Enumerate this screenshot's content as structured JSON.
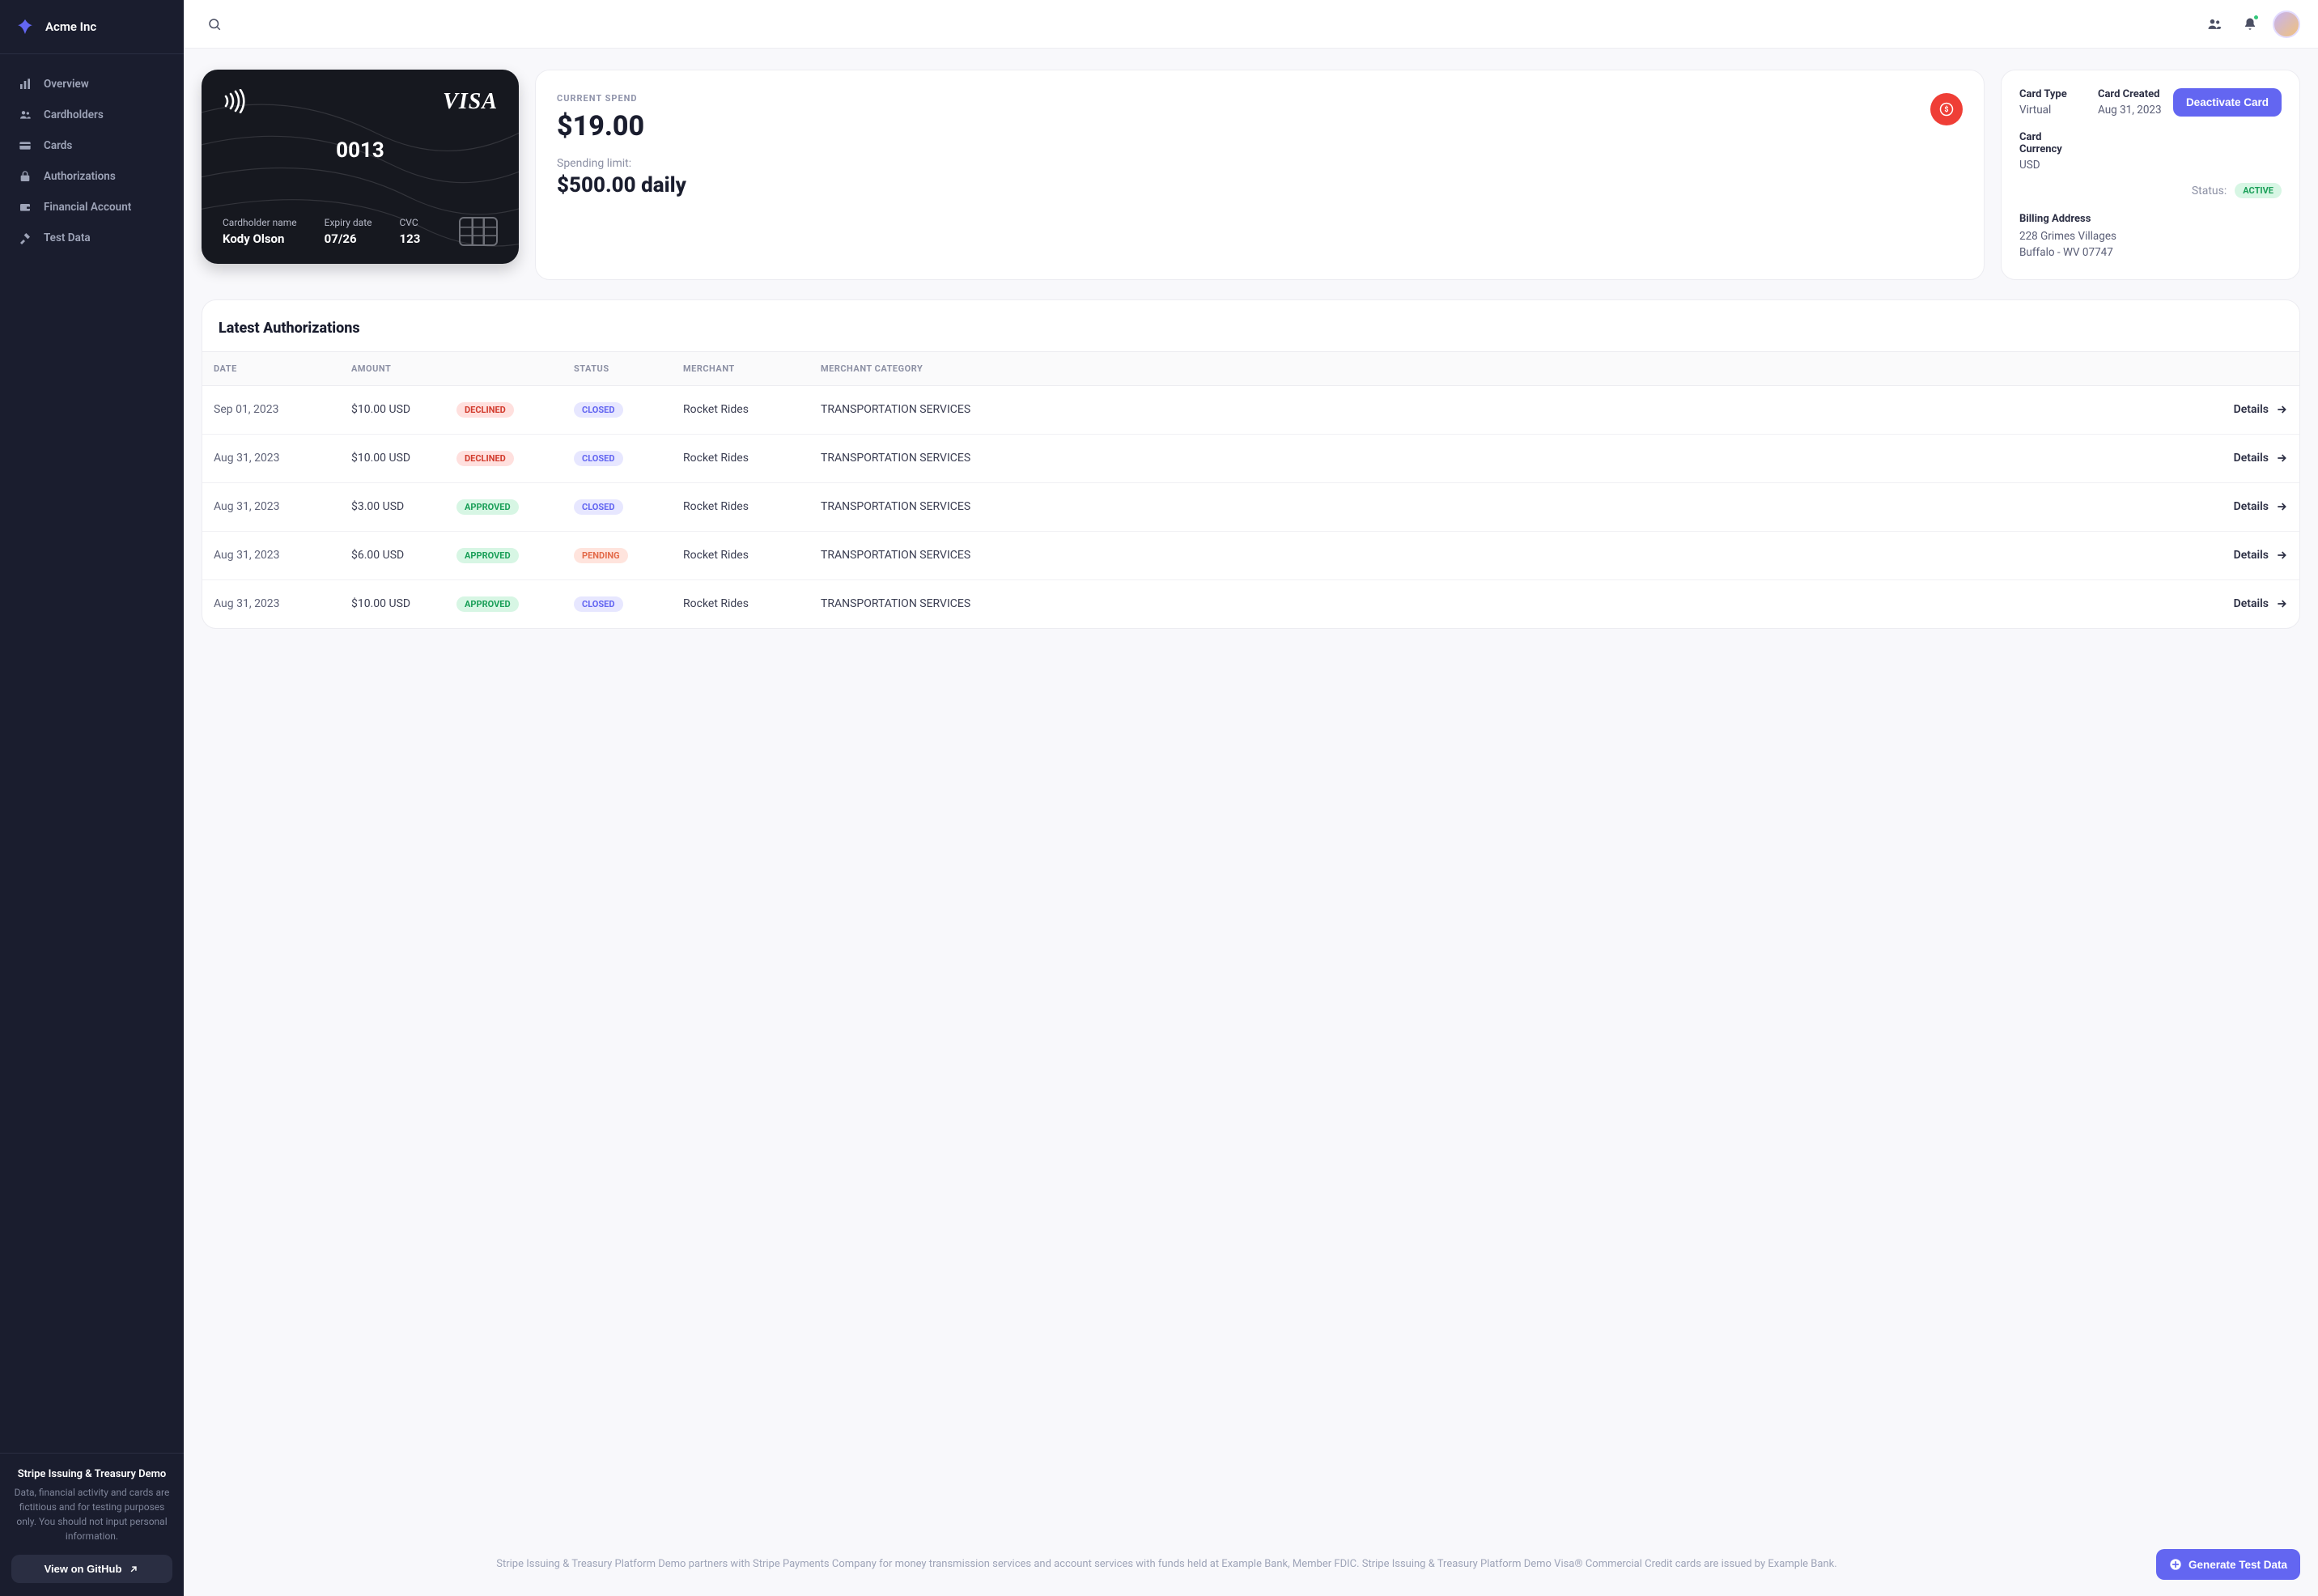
{
  "brand": {
    "name": "Acme Inc"
  },
  "sidebar": {
    "items": [
      {
        "label": "Overview",
        "icon": "bar-chart"
      },
      {
        "label": "Cardholders",
        "icon": "people"
      },
      {
        "label": "Cards",
        "icon": "card"
      },
      {
        "label": "Authorizations",
        "icon": "lock"
      },
      {
        "label": "Financial Account",
        "icon": "wallet"
      },
      {
        "label": "Test Data",
        "icon": "tools"
      }
    ],
    "footer": {
      "title": "Stripe Issuing & Treasury Demo",
      "desc": "Data, financial activity and cards are fictitious and for testing purposes only. You should not input personal information.",
      "github_label": "View on GitHub"
    }
  },
  "card": {
    "brand": "VISA",
    "last4": "0013",
    "holder_label": "Cardholder name",
    "holder": "Kody Olson",
    "expiry_label": "Expiry date",
    "expiry": "07/26",
    "cvc_label": "CVC",
    "cvc": "123"
  },
  "spend": {
    "label": "CURRENT SPEND",
    "amount": "$19.00",
    "limit_label": "Spending limit:",
    "limit_value": "$500.00 daily"
  },
  "details": {
    "type_label": "Card Type",
    "type_value": "Virtual",
    "created_label": "Card Created",
    "created_value": "Aug 31, 2023",
    "currency_label": "Card Currency",
    "currency_value": "USD",
    "deactivate_label": "Deactivate Card",
    "status_label": "Status:",
    "status_value": "ACTIVE",
    "billing_label": "Billing Address",
    "billing_line1": "228 Grimes Villages",
    "billing_line2": "Buffalo - WV 07747"
  },
  "colors": {
    "accent": "#6366f1",
    "danger": "#ef3e36",
    "success": "#1a9f58"
  },
  "table": {
    "title": "Latest Authorizations",
    "headers": {
      "date": "DATE",
      "amount": "AMOUNT",
      "status": "STATUS",
      "merchant": "MERCHANT",
      "category": "MERCHANT CATEGORY"
    },
    "details_label": "Details",
    "rows": [
      {
        "date": "Sep 01, 2023",
        "amount": "$10.00 USD",
        "approval": "DECLINED",
        "status": "CLOSED",
        "merchant": "Rocket Rides",
        "category": "TRANSPORTATION SERVICES"
      },
      {
        "date": "Aug 31, 2023",
        "amount": "$10.00 USD",
        "approval": "DECLINED",
        "status": "CLOSED",
        "merchant": "Rocket Rides",
        "category": "TRANSPORTATION SERVICES"
      },
      {
        "date": "Aug 31, 2023",
        "amount": "$3.00 USD",
        "approval": "APPROVED",
        "status": "CLOSED",
        "merchant": "Rocket Rides",
        "category": "TRANSPORTATION SERVICES"
      },
      {
        "date": "Aug 31, 2023",
        "amount": "$6.00 USD",
        "approval": "APPROVED",
        "status": "PENDING",
        "merchant": "Rocket Rides",
        "category": "TRANSPORTATION SERVICES"
      },
      {
        "date": "Aug 31, 2023",
        "amount": "$10.00 USD",
        "approval": "APPROVED",
        "status": "CLOSED",
        "merchant": "Rocket Rides",
        "category": "TRANSPORTATION SERVICES"
      }
    ]
  },
  "footer": {
    "disclaimer": "Stripe Issuing & Treasury Platform Demo partners with Stripe Payments Company for money transmission services and account services with funds held at Example Bank, Member FDIC. Stripe Issuing & Treasury Platform Demo Visa® Commercial Credit cards are issued by Example Bank.",
    "generate_label": "Generate Test Data"
  }
}
